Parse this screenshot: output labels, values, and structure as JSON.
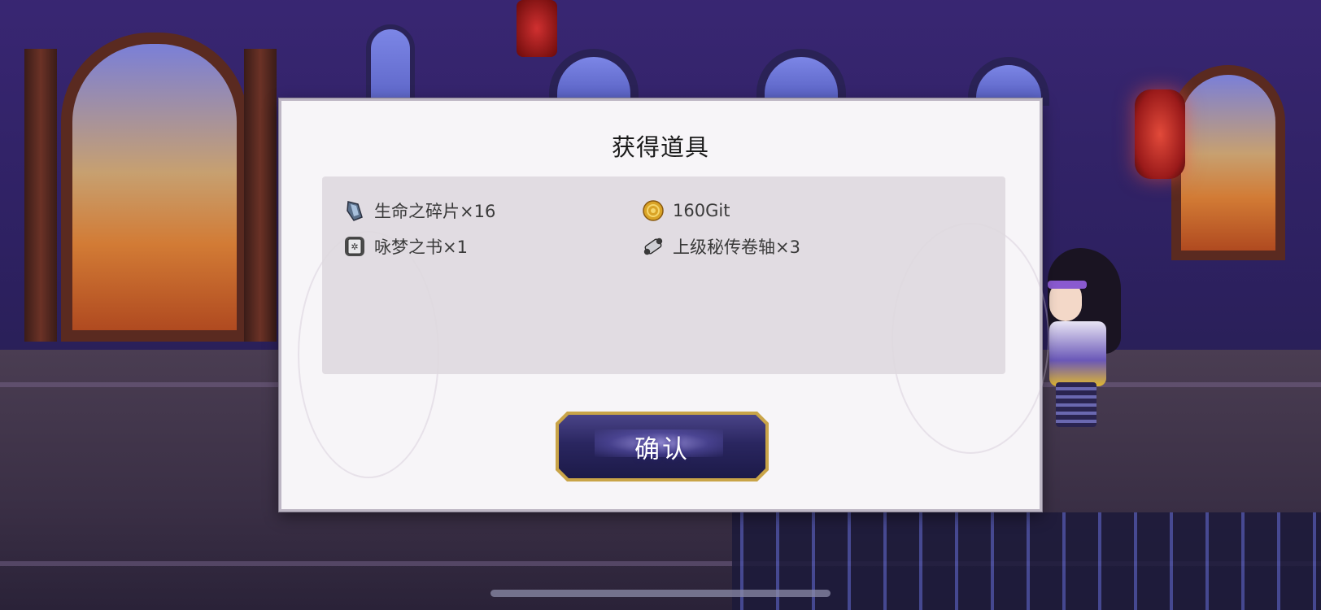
{
  "dialog": {
    "title": "获得道具",
    "confirm_label": "确认"
  },
  "items": [
    {
      "icon": "crystal-shard-icon",
      "label": "生命之碎片×16"
    },
    {
      "icon": "gold-coin-icon",
      "label": "160Git"
    },
    {
      "icon": "book-icon",
      "label": "咏梦之书×1"
    },
    {
      "icon": "scroll-icon",
      "label": "上级秘传卷轴×3"
    }
  ],
  "colors": {
    "dialog_bg": "#f7f5f8",
    "panel_bg": "#ded8de",
    "button_gold": "#c9a448",
    "button_navy": "#2a2660"
  }
}
